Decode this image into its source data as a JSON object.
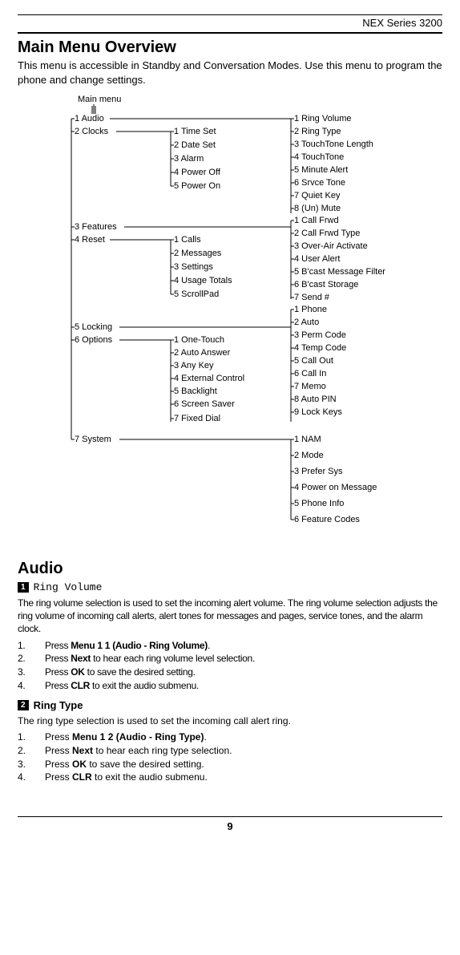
{
  "product": "NEX Series 3200",
  "title": "Main Menu Overview",
  "intro": "This menu is accessible in Standby and Conversation Modes. Use this menu to program the phone and change settings.",
  "tree": {
    "root": "Main menu",
    "level1": [
      "1  Audio",
      "2  Clocks",
      "3  Features",
      "4  Reset",
      "5  Locking",
      "6  Options",
      "7  System"
    ],
    "clocks_sub": [
      "1  Time Set",
      "2  Date Set",
      "3  Alarm",
      "4  Power Off",
      "5  Power On"
    ],
    "audio_sub": [
      "1  Ring Volume",
      "2  Ring Type",
      "3  TouchTone Length",
      "4  TouchTone",
      "5  Minute Alert",
      "6  Srvce Tone",
      "7  Quiet Key",
      "8  (Un) Mute"
    ],
    "reset_sub": [
      "1  Calls",
      "2  Messages",
      "3  Settings",
      "4  Usage Totals",
      "5  ScrollPad"
    ],
    "features_sub": [
      "1  Call Frwd",
      "2  Call Frwd Type",
      "3  Over-Air Activate",
      "4  User Alert",
      "5  B'cast Message Filter",
      "6  B'cast Storage",
      "7  Send #"
    ],
    "options_sub": [
      "1  One-Touch",
      "2  Auto Answer",
      "3  Any Key",
      "4  External Control",
      "5  Backlight",
      "6  Screen Saver",
      "7  Fixed Dial"
    ],
    "locking_sub": [
      "1  Phone",
      "2  Auto",
      "3  Perm Code",
      "4  Temp Code",
      "5  Call Out",
      "6  Call In",
      "7  Memo",
      "8  Auto PIN",
      "9  Lock Keys"
    ],
    "system_sub": [
      "1  NAM",
      "2  Mode",
      "3  Prefer Sys",
      "4  Power on  Message",
      "5  Phone Info",
      "6  Feature Codes"
    ]
  },
  "audio_section": {
    "heading": "Audio",
    "ring_volume": {
      "icon": "1",
      "title": "Ring Volume",
      "desc": "The ring volume selection is used to set the incoming alert volume.  The ring volume selection adjusts the ring volume of incoming call alerts, alert tones for messages and pages, service tones, and the alarm clock.",
      "steps": [
        "Press Menu 1 1 (Audio - Ring Volume).",
        "Press Next to hear each ring volume level selection.",
        "Press OK to save the desired setting.",
        "Press CLR to exit the audio submenu."
      ]
    },
    "ring_type": {
      "icon": "2",
      "title": "Ring Type",
      "desc": "The ring type selection is used to set the incoming call alert ring.",
      "steps": [
        "Press Menu 1 2 (Audio - Ring Type).",
        "Press Next to hear each ring type selection.",
        "Press OK to save the desired setting.",
        "Press CLR to exit the audio submenu."
      ]
    }
  },
  "page_number": "9"
}
